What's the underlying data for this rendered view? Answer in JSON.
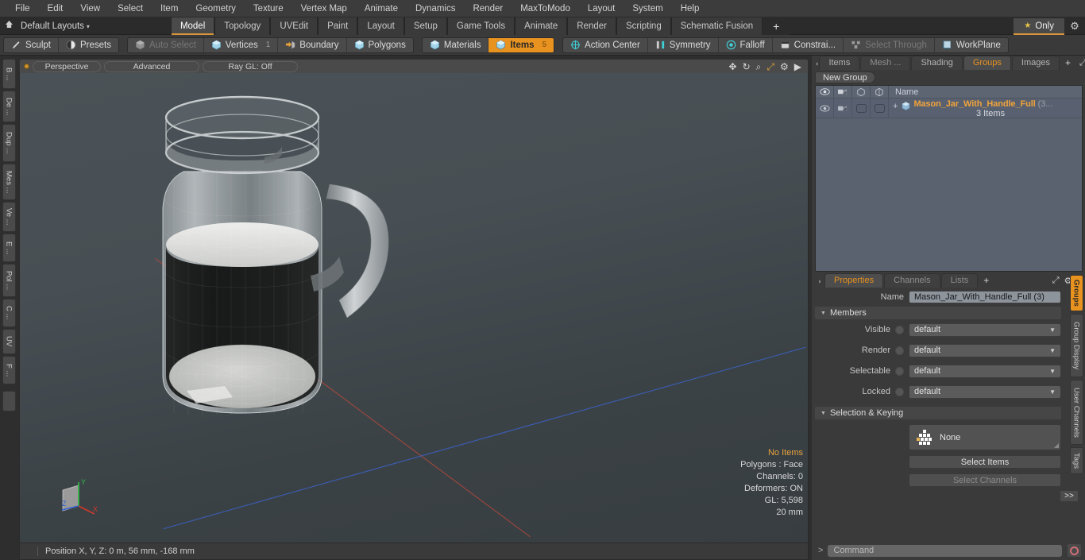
{
  "menubar": {
    "items": [
      "File",
      "Edit",
      "View",
      "Select",
      "Item",
      "Geometry",
      "Texture",
      "Vertex Map",
      "Animate",
      "Dynamics",
      "Render",
      "MaxToModo",
      "Layout",
      "System",
      "Help"
    ]
  },
  "layoutbar": {
    "home_icon": "home-icon",
    "layout_label": "Default Layouts",
    "caret": "▾",
    "tabs": [
      {
        "label": "Model",
        "active": true
      },
      {
        "label": "Topology",
        "active": false
      },
      {
        "label": "UVEdit",
        "active": false
      },
      {
        "label": "Paint",
        "active": false
      },
      {
        "label": "Layout",
        "active": false
      },
      {
        "label": "Setup",
        "active": false
      },
      {
        "label": "Game Tools",
        "active": false
      },
      {
        "label": "Animate",
        "active": false
      },
      {
        "label": "Render",
        "active": false
      },
      {
        "label": "Scripting",
        "active": false
      },
      {
        "label": "Schematic Fusion",
        "active": false
      }
    ],
    "add_tab": "+",
    "only_label": "Only",
    "star": "★",
    "gear": "⚙"
  },
  "modebar": {
    "left_group": [
      {
        "label": "Sculpt",
        "icon": "pencil-icon",
        "active": false,
        "dim": false
      },
      {
        "label": "Presets",
        "icon": "sphere-icon",
        "active": false,
        "dim": false
      }
    ],
    "select_group": [
      {
        "label": "Auto Select",
        "icon": "cube-icon",
        "active": false,
        "dim": true,
        "count": ""
      },
      {
        "label": "Vertices",
        "icon": "cube-icon",
        "active": false,
        "dim": false,
        "count": "1"
      },
      {
        "label": "Boundary",
        "icon": "boundary-icon",
        "active": false,
        "dim": false,
        "count": ""
      },
      {
        "label": "Polygons",
        "icon": "cube-icon",
        "active": false,
        "dim": false,
        "count": ""
      }
    ],
    "mat_group": [
      {
        "label": "Materials",
        "icon": "cube-icon",
        "active": false,
        "dim": false,
        "count": ""
      },
      {
        "label": "Items",
        "icon": "cube-icon",
        "active": true,
        "dim": false,
        "count": "5"
      }
    ],
    "right_group": [
      {
        "label": "Action Center",
        "icon": "target-icon",
        "active": false,
        "dim": false
      },
      {
        "label": "Symmetry",
        "icon": "symmetry-icon",
        "active": false,
        "dim": false
      },
      {
        "label": "Falloff",
        "icon": "falloff-icon",
        "active": false,
        "dim": false
      },
      {
        "label": "Constrai...",
        "icon": "constraint-icon",
        "active": false,
        "dim": false
      },
      {
        "label": "Select Through",
        "icon": "select-through-icon",
        "active": false,
        "dim": true
      },
      {
        "label": "WorkPlane",
        "icon": "workplane-icon",
        "active": false,
        "dim": false
      }
    ]
  },
  "left_strip": {
    "tabs": [
      "B ...",
      "De ...",
      "Dup ...",
      "Mes ...",
      "Ve ...",
      "E ...",
      "Pol ...",
      "C ...",
      "UV",
      "F ..."
    ]
  },
  "viewport": {
    "pills": [
      "Perspective",
      "Advanced",
      "Ray GL: Off"
    ],
    "icons": [
      "move-icon",
      "rotate-icon",
      "zoom-icon",
      "fit-icon",
      "gear-icon",
      "play-icon"
    ],
    "stats": [
      "No Items",
      "Polygons : Face",
      "Channels: 0",
      "Deformers: ON",
      "GL: 5,598",
      "20 mm"
    ],
    "gizmo_axes": [
      "X",
      "Y",
      "Z"
    ],
    "status_text": "Position X, Y, Z:   0 m, 56 mm, -168 mm"
  },
  "right_panel": {
    "tabs": [
      {
        "label": "Items",
        "active": false
      },
      {
        "label": "Mesh ...",
        "active": false
      },
      {
        "label": "Shading",
        "active": false
      },
      {
        "label": "Groups",
        "active": true
      },
      {
        "label": "Images",
        "active": false
      }
    ],
    "add_tab": "+",
    "expand_icon": "expand-icon",
    "more_icon": "chevron-right-icon",
    "new_group_label": "New Group",
    "group_list": {
      "columns": [
        "eye-icon",
        "render-icon",
        "shade-icon",
        "wire-icon",
        "Name"
      ],
      "rows": [
        {
          "name": "Mason_Jar_With_Handle_Full",
          "suffix": "(3...",
          "sub": "3 Items",
          "expander": "+"
        }
      ]
    }
  },
  "properties": {
    "tabs": [
      {
        "label": "Properties",
        "active": true
      },
      {
        "label": "Channels",
        "active": false
      },
      {
        "label": "Lists",
        "active": false
      }
    ],
    "add_tab": "+",
    "name_label": "Name",
    "name_value": "Mason_Jar_With_Handle_Full (3)",
    "members_header": "Members",
    "fields": [
      {
        "label": "Visible",
        "value": "default"
      },
      {
        "label": "Render",
        "value": "default"
      },
      {
        "label": "Selectable",
        "value": "default"
      },
      {
        "label": "Locked",
        "value": "default"
      }
    ],
    "selection_header": "Selection & Keying",
    "selection_none": "None",
    "select_items_label": "Select Items",
    "select_channels_label": "Select Channels",
    "more_button": ">>"
  },
  "right_strip": {
    "tabs": [
      {
        "label": "Groups",
        "active": true
      },
      {
        "label": "Group Display",
        "active": false
      },
      {
        "label": "User Channels",
        "active": false
      },
      {
        "label": "Tags",
        "active": false
      }
    ]
  },
  "command_bar": {
    "prompt": ">",
    "placeholder": "Command",
    "record_icon": "record-icon"
  },
  "colors": {
    "accent": "#e8921f",
    "panel": "#3a3a3a",
    "list_bg": "#5a6270",
    "axis_x": "#c0392b",
    "axis_z": "#2f5fd0"
  }
}
